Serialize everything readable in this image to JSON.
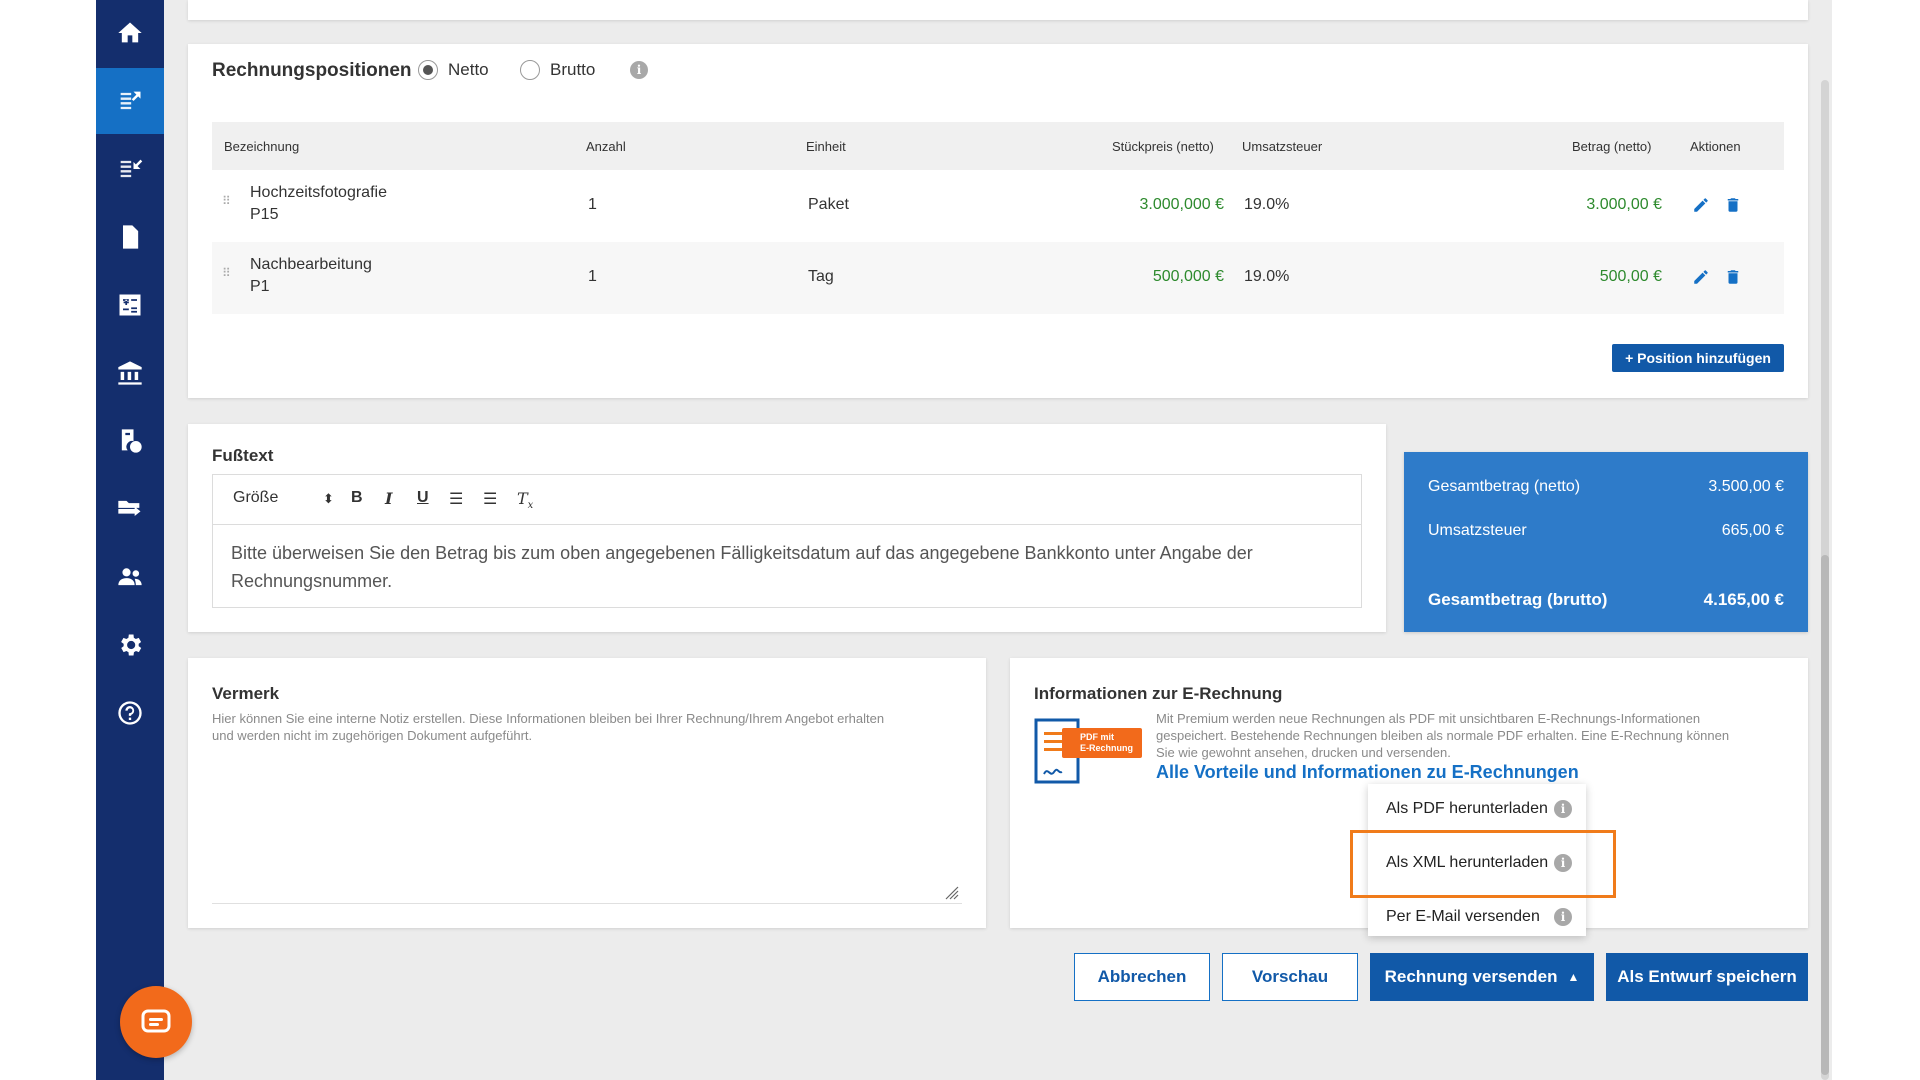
{
  "colors": {
    "sidebar": "#142e6d",
    "accent": "#1570c5",
    "button": "#1159a8",
    "totals": "#2e7bc9",
    "money_green": "#2d8a2d",
    "highlight": "#f07b1a",
    "chat": "#f26a1b"
  },
  "sidebar": {
    "items": [
      {
        "icon": "home-icon"
      },
      {
        "icon": "outgoing-invoices-icon",
        "active": true
      },
      {
        "icon": "incoming-invoices-icon"
      },
      {
        "icon": "document-icon"
      },
      {
        "icon": "calculator-icon"
      },
      {
        "icon": "bank-icon"
      },
      {
        "icon": "tax-document-icon"
      },
      {
        "icon": "folder-export-icon"
      },
      {
        "icon": "contacts-icon"
      },
      {
        "icon": "gear-icon"
      },
      {
        "icon": "help-icon"
      }
    ]
  },
  "positions": {
    "title": "Rechnungspositionen",
    "netto_label": "Netto",
    "brutto_label": "Brutto",
    "selected": "Netto",
    "headers": {
      "name": "Bezeichnung",
      "qty": "Anzahl",
      "unit": "Einheit",
      "unit_price": "Stückpreis (netto)",
      "vat": "Umsatzsteuer",
      "amount": "Betrag (netto)",
      "actions": "Aktionen"
    },
    "rows": [
      {
        "name": "Hochzeitsfotografie",
        "code": "P15",
        "qty": "1",
        "unit": "Paket",
        "unit_price": "3.000,000 €",
        "vat": "19.0%",
        "amount": "3.000,00 €"
      },
      {
        "name": "Nachbearbeitung",
        "code": "P1",
        "qty": "1",
        "unit": "Tag",
        "unit_price": "500,000 €",
        "vat": "19.0%",
        "amount": "500,00 €"
      }
    ],
    "add_button": "+ Position hinzufügen"
  },
  "footer_text": {
    "title": "Fußtext",
    "size_label": "Größe",
    "body": "Bitte überweisen Sie den Betrag bis zum oben angegebenen Fälligkeitsdatum auf das angegebene Bankkonto unter Angabe der Rechnungsnummer."
  },
  "totals": {
    "net_label": "Gesamtbetrag (netto)",
    "net_value": "3.500,00 €",
    "vat_label": "Umsatzsteuer",
    "vat_value": "665,00 €",
    "gross_label": "Gesamtbetrag (brutto)",
    "gross_value": "4.165,00 €"
  },
  "note": {
    "title": "Vermerk",
    "description_1": "Hier können Sie eine interne Notiz erstellen. Diese Informationen bleiben bei Ihrer Rechnung/Ihrem Angebot erhalten",
    "description_2": "und werden nicht im zugehörigen Dokument aufgeführt."
  },
  "einvoice": {
    "title": "Informationen zur E-Rechnung",
    "description_1": "Mit Premium werden neue Rechnungen als PDF mit unsichtbaren E-Rechnungs-Informationen",
    "description_2": "gespeichert. Bestehende Rechnungen bleiben als normale PDF erhalten. Eine E-Rechnung können",
    "description_3": "Sie wie gewohnt ansehen, drucken und versenden.",
    "link": "Alle Vorteile und Informationen zu E-Rechnungen",
    "badge_line1": "PDF mit",
    "badge_line2": "E-Rechnung"
  },
  "dropdown": {
    "items": [
      "Als PDF herunterladen",
      "Als XML herunterladen",
      "Per E-Mail versenden"
    ]
  },
  "buttons": {
    "cancel": "Abbrechen",
    "preview": "Vorschau",
    "send": "Rechnung versenden",
    "draft": "Als Entwurf speichern"
  }
}
